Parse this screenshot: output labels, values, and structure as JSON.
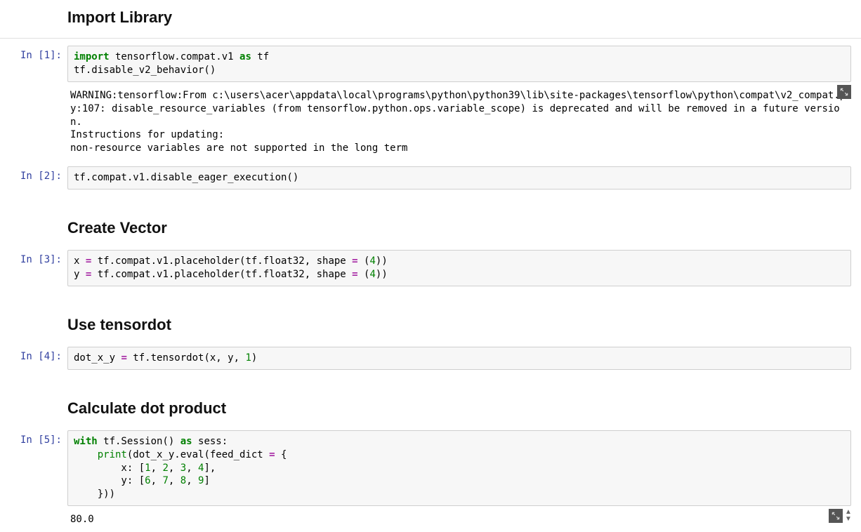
{
  "headings": {
    "import_library": "Import Library",
    "create_vector": "Create Vector",
    "use_tensordot": "Use tensordot",
    "calculate_dot": "Calculate dot product"
  },
  "prompts": {
    "in1": "In [1]:",
    "in2": "In [2]:",
    "in3": "In [3]:",
    "in4": "In [4]:",
    "in5": "In [5]:"
  },
  "code": {
    "c1_l1_kw1": "import",
    "c1_l1_mid": " tensorflow.compat.v1 ",
    "c1_l1_kw2": "as",
    "c1_l1_end": " tf",
    "c1_l2": "tf.disable_v2_behavior()",
    "c2_l1": "tf.compat.v1.disable_eager_execution()",
    "c3_l1_a": "x ",
    "c3_l1_eq": "=",
    "c3_l1_b": " tf.compat.v1.placeholder(tf.float32, shape ",
    "c3_l1_eq2": "=",
    "c3_l1_c": " (",
    "c3_l1_num": "4",
    "c3_l1_d": "))",
    "c3_l2_a": "y ",
    "c3_l2_eq": "=",
    "c3_l2_b": " tf.compat.v1.placeholder(tf.float32, shape ",
    "c3_l2_eq2": "=",
    "c3_l2_c": " (",
    "c3_l2_num": "4",
    "c3_l2_d": "))",
    "c4_l1_a": "dot_x_y ",
    "c4_l1_eq": "=",
    "c4_l1_b": " tf.tensordot(x, y, ",
    "c4_l1_num": "1",
    "c4_l1_c": ")",
    "c5_l1_kw1": "with",
    "c5_l1_a": " tf.Session() ",
    "c5_l1_kw2": "as",
    "c5_l1_b": " sess:",
    "c5_l2_indent": "    ",
    "c5_l2_func": "print",
    "c5_l2_a": "(dot_x_y.eval(feed_dict ",
    "c5_l2_eq": "=",
    "c5_l2_b": " {",
    "c5_l3_a": "        x: [",
    "c5_l3_n1": "1",
    "c5_l3_s1": ", ",
    "c5_l3_n2": "2",
    "c5_l3_s2": ", ",
    "c5_l3_n3": "3",
    "c5_l3_s3": ", ",
    "c5_l3_n4": "4",
    "c5_l3_b": "],",
    "c5_l4_a": "        y: [",
    "c5_l4_n1": "6",
    "c5_l4_s1": ", ",
    "c5_l4_n2": "7",
    "c5_l4_s2": ", ",
    "c5_l4_n3": "8",
    "c5_l4_s3": ", ",
    "c5_l4_n4": "9",
    "c5_l4_b": "]",
    "c5_l5": "    }))"
  },
  "output": {
    "o1": "WARNING:tensorflow:From c:\\users\\acer\\appdata\\local\\programs\\python\\python39\\lib\\site-packages\\tensorflow\\python\\compat\\v2_compat.py:107: disable_resource_variables (from tensorflow.python.ops.variable_scope) is deprecated and will be removed in a future version.\nInstructions for updating:\nnon-resource variables are not supported in the long term",
    "o5": "80.0"
  }
}
